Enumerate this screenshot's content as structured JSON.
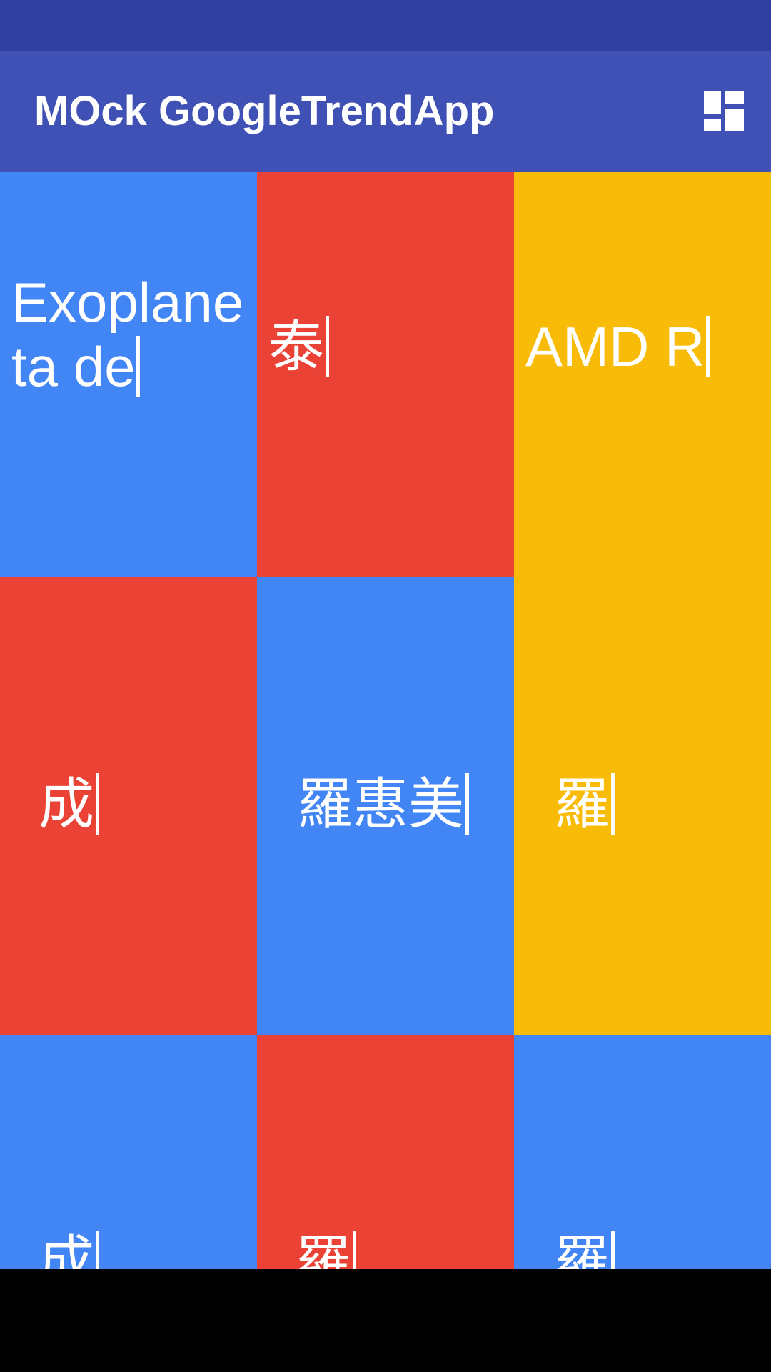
{
  "app_bar": {
    "title": "MOck GoogleTrendApp",
    "layout_icon": "dashboard-layout-icon"
  },
  "colors": {
    "status_bar": "#303F9F",
    "app_bar": "#3F51B5",
    "blue": "#4285F4",
    "red": "#EA4335",
    "yellow": "#F8BB07",
    "text": "#FFFFFF",
    "nav_bar": "#000000"
  },
  "tiles": [
    {
      "color": "blue",
      "text": "Exoplaneta de"
    },
    {
      "color": "red",
      "text": "泰"
    },
    {
      "color": "yellow",
      "text": "AMD R"
    },
    {
      "color": "red",
      "text": "成"
    },
    {
      "color": "blue",
      "text": "羅惠美"
    },
    {
      "color": "blue",
      "text": "成"
    },
    {
      "color": "red",
      "text": "羅"
    },
    {
      "color": "blue",
      "text": "羅"
    }
  ],
  "right_column_lower": {
    "color": "yellow",
    "text": "羅"
  }
}
